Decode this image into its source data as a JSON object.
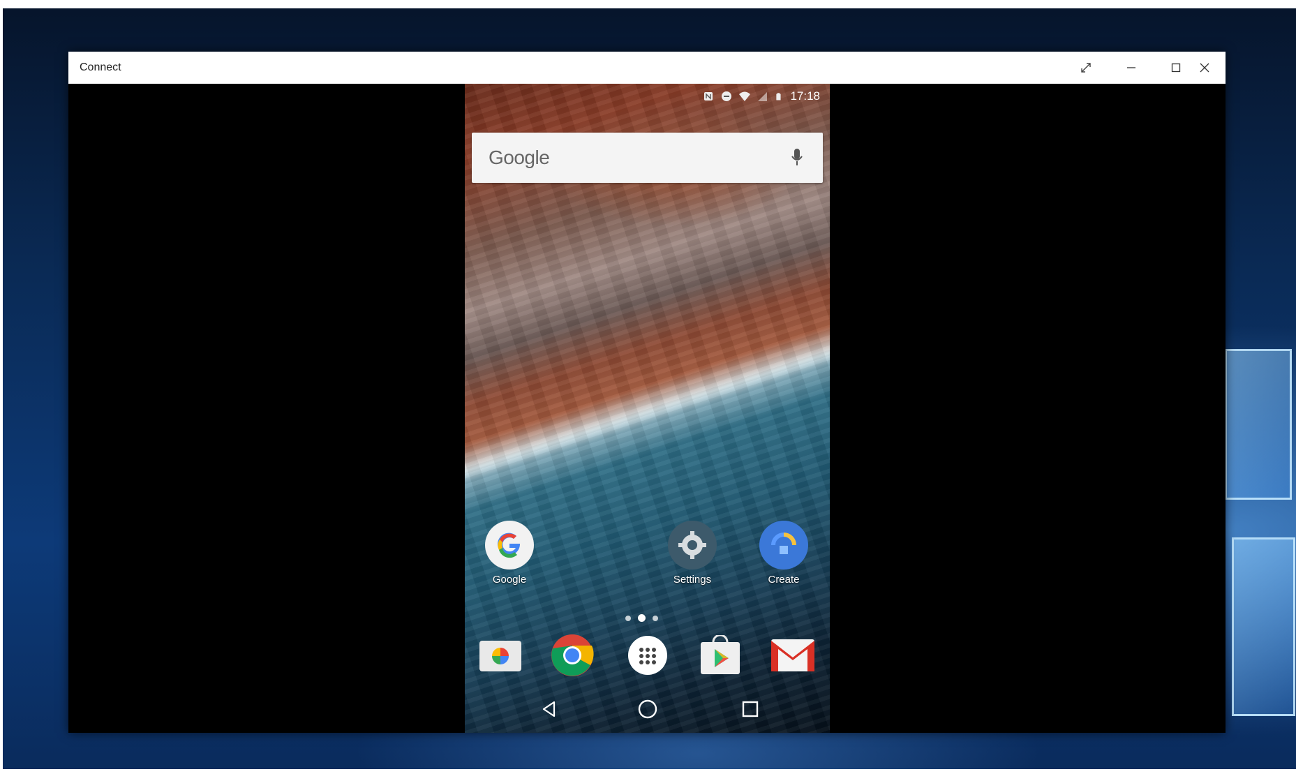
{
  "window": {
    "title": "Connect"
  },
  "phone": {
    "status": {
      "time": "17:18"
    },
    "search": {
      "logo_text": "Google"
    },
    "home_apps": [
      {
        "label": "Google",
        "icon": "google-app-icon"
      },
      {
        "label": "Settings",
        "icon": "settings-app-icon"
      },
      {
        "label": "Create",
        "icon": "create-app-icon"
      }
    ],
    "dock": [
      {
        "icon": "photos-app-icon"
      },
      {
        "icon": "chrome-app-icon"
      },
      {
        "icon": "app-drawer-icon"
      },
      {
        "icon": "play-store-app-icon"
      },
      {
        "icon": "gmail-app-icon"
      }
    ],
    "nav": [
      "back-icon",
      "home-icon",
      "recents-icon"
    ]
  },
  "colors": {
    "titlebar_bg": "#ffffff",
    "desktop_accent": "#0d3a78"
  }
}
